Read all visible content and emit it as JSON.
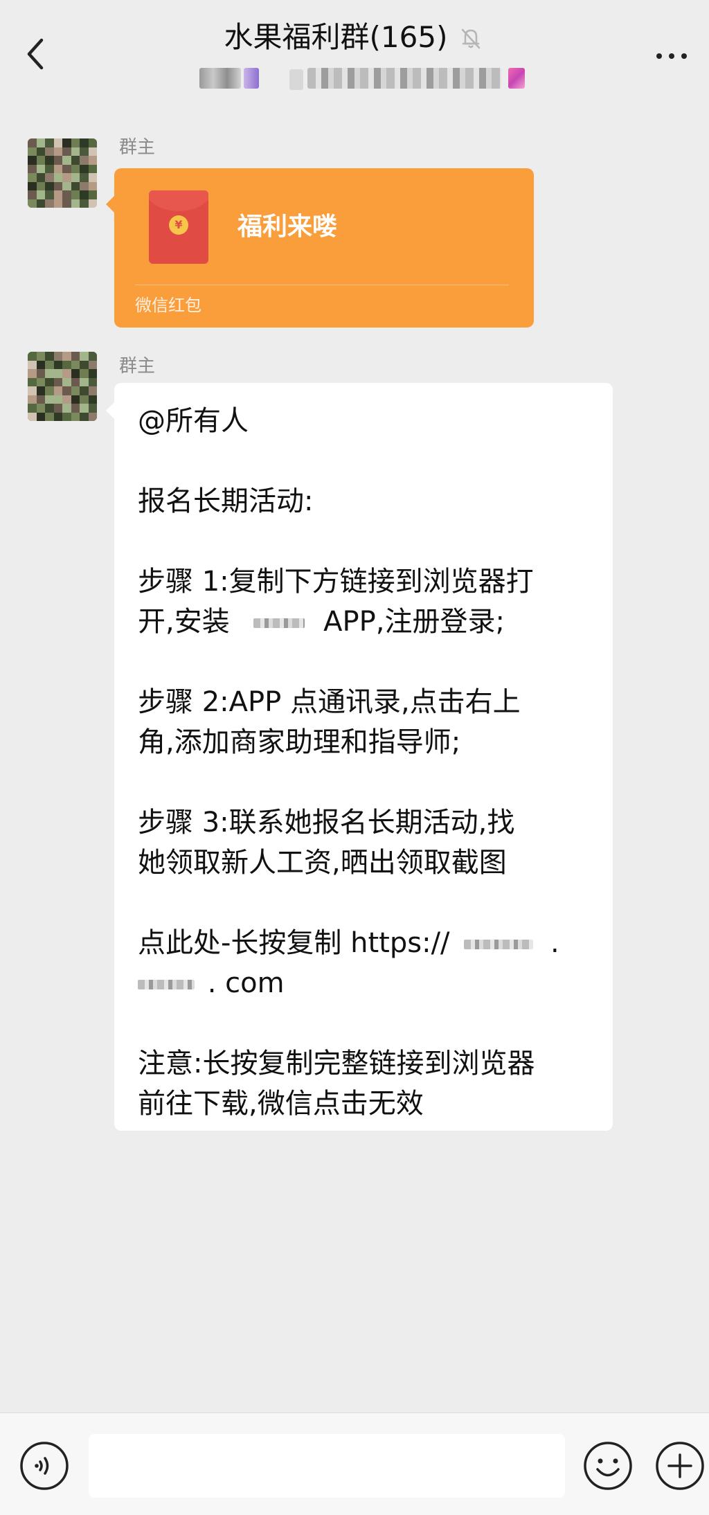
{
  "header": {
    "title": "水果福利群(165)",
    "icons": {
      "back": "chevron-left-icon",
      "mute": "bell-off-icon",
      "more": "more-dots-icon"
    }
  },
  "messages": [
    {
      "sender": "群主",
      "type": "red-packet",
      "packet_title": "福利来喽",
      "packet_footer": "微信红包"
    },
    {
      "sender": "群主",
      "type": "text",
      "lines": {
        "mention": "@所有人",
        "intro": "报名长期活动:",
        "step1_a": "步骤 1:复制下方链接到浏览器打",
        "step1_b_pre": "开,安装",
        "step1_b_post": "APP,注册登录;",
        "step2_a": "步骤 2:APP 点通讯录,点击右上",
        "step2_b": "角,添加商家助理和指导师;",
        "step3_a": "步骤 3:联系她报名长期活动,找",
        "step3_b": "她领取新人工资,晒出领取截图",
        "link_a": "点此处-长按复制 https://",
        "link_a_tail": ".",
        "link_b_tail": ". com",
        "note_a": "注意:长按复制完整链接到浏览器",
        "note_b": "前往下载,微信点击无效"
      }
    }
  ],
  "bottom_bar": {
    "input_value": "",
    "icons": {
      "voice": "voice-icon",
      "emoji": "emoji-icon",
      "plus": "plus-icon"
    }
  },
  "colors": {
    "background": "#ededed",
    "red_packet": "#fa9d3b",
    "bubble": "#ffffff"
  }
}
